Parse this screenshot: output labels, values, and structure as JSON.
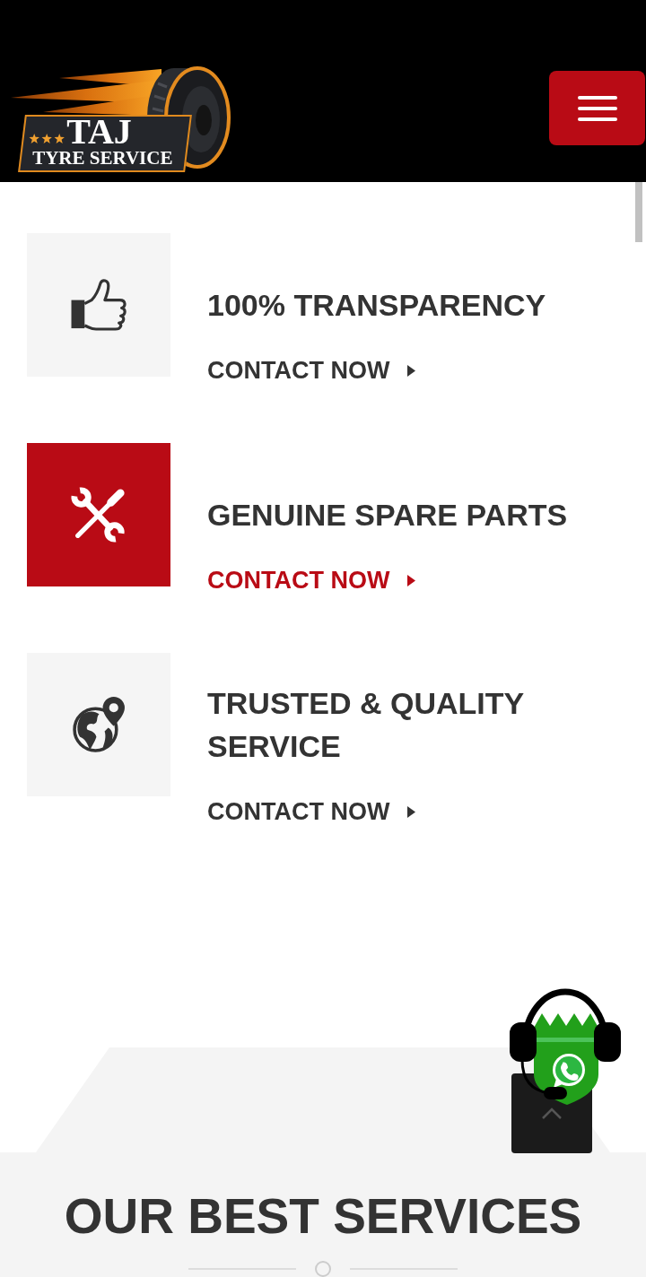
{
  "header": {
    "logo": {
      "title": "TAJ",
      "subtitle": "TYRE SERVICE"
    }
  },
  "features": [
    {
      "title": "100% TRANSPARENCY",
      "link": "CONTACT NOW",
      "active": false
    },
    {
      "title": "GENUINE SPARE PARTS",
      "link": "CONTACT NOW",
      "active": true
    },
    {
      "title": "TRUSTED & QUALITY SERVICE",
      "link": "CONTACT NOW",
      "active": false
    }
  ],
  "services_section": {
    "title": "OUR BEST SERVICES"
  }
}
